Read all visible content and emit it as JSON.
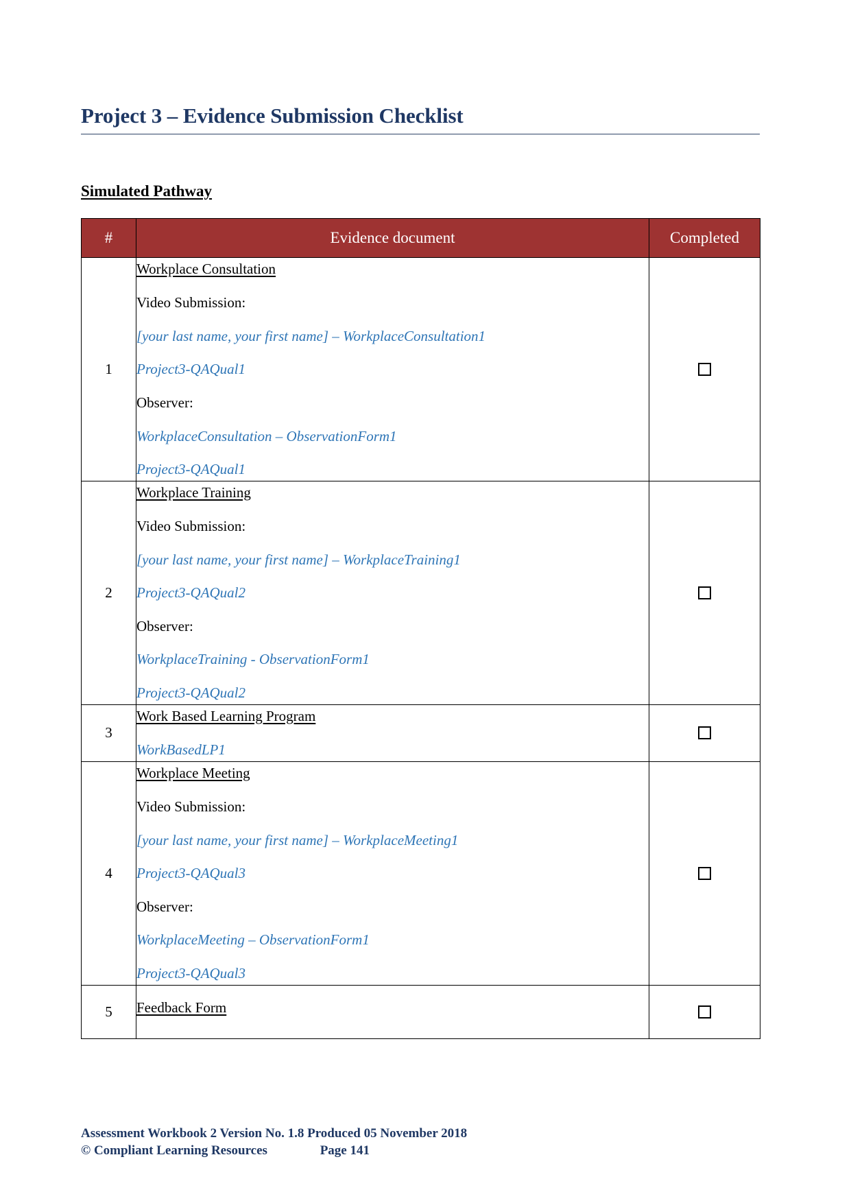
{
  "document": {
    "title": "Project 3 – Evidence Submission Checklist",
    "section_heading": "Simulated Pathway"
  },
  "table": {
    "headers": {
      "num": "#",
      "document": "Evidence document",
      "completed": "Completed"
    },
    "header_bg": "#9E3332",
    "header_text_color": "#FFFFFF",
    "link_color": "#2E75B6",
    "rows": [
      {
        "num": "1",
        "title": "Workplace Consultation",
        "video_label": "Video Submission:",
        "video_file": "[your last name, your first name] – WorkplaceConsultation1",
        "video_code": "Project3-QAQual1",
        "observer_label": "Observer:",
        "observer_file": "WorkplaceConsultation – ObservationForm1",
        "observer_code": "Project3-QAQual1",
        "completed": false
      },
      {
        "num": "2",
        "title": "Workplace Training",
        "video_label": "Video Submission:",
        "video_file": "[your last name, your first name] – WorkplaceTraining1",
        "video_code": "Project3-QAQual2",
        "observer_label": "Observer:",
        "observer_file": "WorkplaceTraining - ObservationForm1",
        "observer_code": "Project3-QAQual2",
        "completed": false
      },
      {
        "num": "3",
        "title": "Work Based Learning Program",
        "video_label": "",
        "video_file": "WorkBasedLP1",
        "video_code": "",
        "observer_label": "",
        "observer_file": "",
        "observer_code": "",
        "completed": false
      },
      {
        "num": "4",
        "title": "Workplace Meeting",
        "video_label": "Video Submission:",
        "video_file": "[your last name, your first name] – WorkplaceMeeting1",
        "video_code": "Project3-QAQual3",
        "observer_label": "Observer:",
        "observer_file": "WorkplaceMeeting – ObservationForm1",
        "observer_code": "Project3-QAQual3",
        "completed": false
      },
      {
        "num": "5",
        "title": "Feedback Form",
        "video_label": "",
        "video_file": "",
        "video_code": "",
        "observer_label": "",
        "observer_file": "",
        "observer_code": "",
        "completed": false
      }
    ]
  },
  "footer": {
    "line1": "Assessment Workbook 2 Version No. 1.8 Produced 05 November 2018",
    "copyright": "© Compliant Learning Resources",
    "page": "Page 141"
  }
}
